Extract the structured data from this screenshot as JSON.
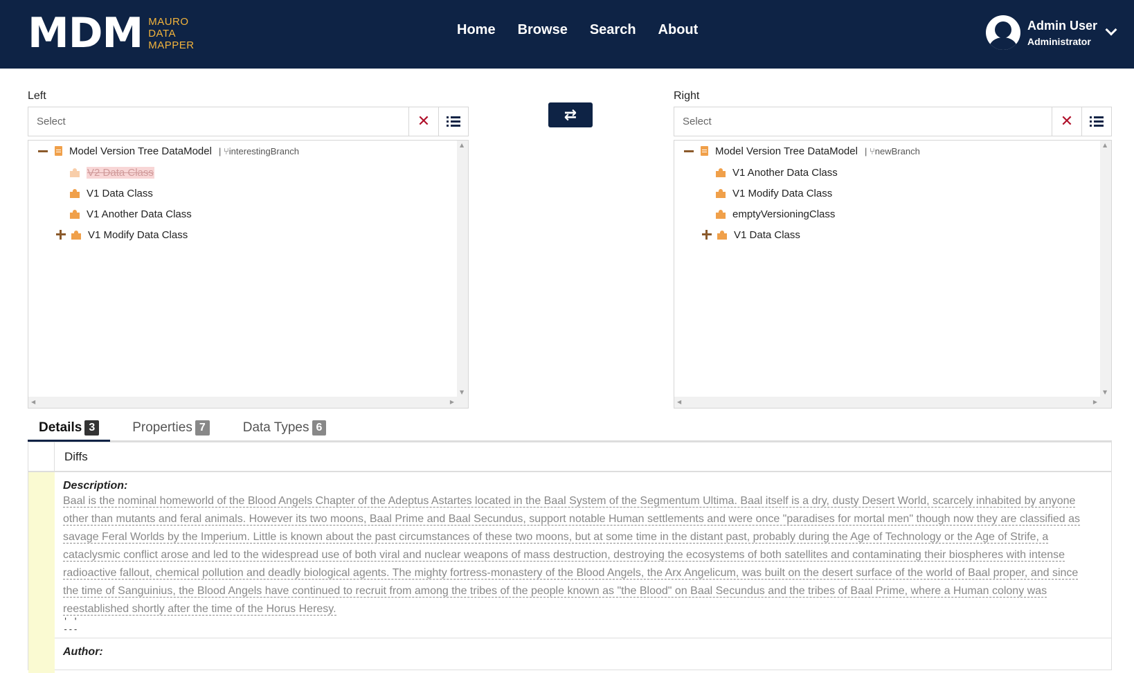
{
  "header": {
    "logo_main": "MDM",
    "logo_sub": [
      "MAURO",
      "DATA",
      "MAPPER"
    ],
    "nav": [
      "Home",
      "Browse",
      "Search",
      "About"
    ],
    "user_name": "Admin User",
    "user_role": "Administrator"
  },
  "left": {
    "label": "Left",
    "placeholder": "Select",
    "model_name": "Model Version Tree DataModel",
    "branch_sep": "|",
    "branch": "interestingBranch",
    "items": [
      "V2 Data Class",
      "V1 Data Class",
      "V1 Another Data Class",
      "V1 Modify Data Class"
    ]
  },
  "right": {
    "label": "Right",
    "placeholder": "Select",
    "model_name": "Model Version Tree DataModel",
    "branch_sep": "|",
    "branch": "newBranch",
    "items": [
      "V1 Another Data Class",
      "V1 Modify Data Class",
      "emptyVersioningClass",
      "V1 Data Class"
    ]
  },
  "swap_icon": "⇄",
  "tabs": [
    {
      "label": "Details",
      "count": "3"
    },
    {
      "label": "Properties",
      "count": "7"
    },
    {
      "label": "Data Types",
      "count": "6"
    }
  ],
  "diffs": {
    "header": "Diffs",
    "description_label": "Description:",
    "description": "Baal is the nominal homeworld of the Blood Angels Chapter of the Adeptus Astartes located in the Baal System of the Segmentum Ultima. Baal itself is a dry, dusty Desert World, scarcely inhabited by anyone other than mutants and feral animals. However its two moons, Baal Prime and Baal Secundus, support notable Human settlements and were once \"paradises for mortal men\" though now they are classified as savage Feral Worlds by the Imperium. Little is known about the past circumstances of these two moons, but at some time in the distant past, probably during the Age of Technology or the Age of Strife, a cataclysmic conflict arose and led to the widespread use of both viral and nuclear weapons of mass destruction, destroying the ecosystems of both satellites and contaminating their biospheres with intense radioactive fallout, chemical pollution and deadly biological agents. The mighty fortress-monastery of the Blood Angels, the Arx Angelicum, was built on the desert surface of the world of Baal proper, and since the time of Sanguinius, the Blood Angels have continued to recruit from among the tribes of the people known as \"the Blood\" on Baal Secundus and the tribes of Baal Prime, where a Human colony was reestablished shortly after the time of the Horus Heresy.",
    "marks_1": "' '",
    "marks_2": "---",
    "author_label": "Author:"
  },
  "colors": {
    "header_bg": "#0e2345",
    "logo_accent": "#f3b43c",
    "icon_orange": "#f0a04a",
    "clear_red": "#b0102a"
  }
}
